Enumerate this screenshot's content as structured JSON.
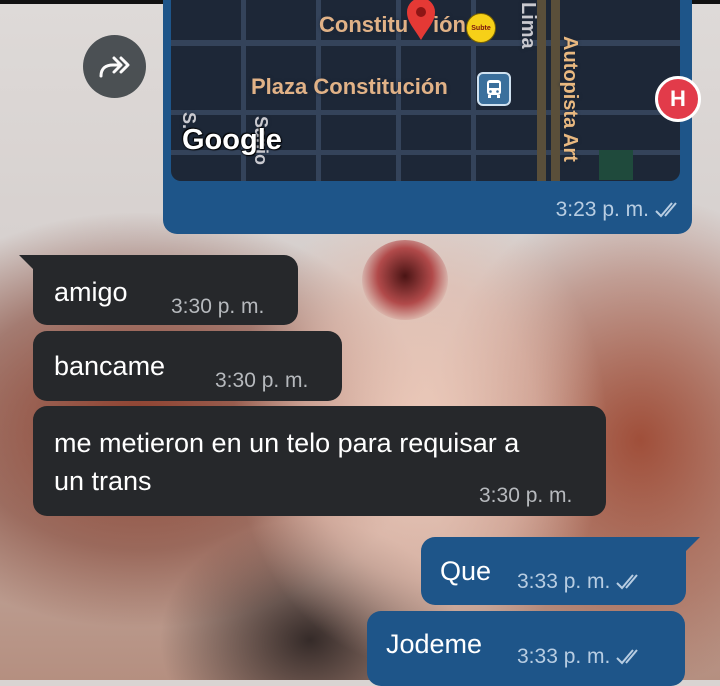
{
  "map": {
    "labels": {
      "constitucion_top": "Constitu",
      "constitucion_end": "ión",
      "plaza": "Plaza Constitución",
      "autopista": "Autopista Art",
      "lima": "Lima",
      "side_left": "S.",
      "side_mid": "Sanjo"
    },
    "subte_text": "Subte",
    "hospital_text": "H",
    "google": "Google",
    "time": "3:23 p. m."
  },
  "messages": [
    {
      "text": "amigo",
      "time": "3:30 p. m.",
      "direction": "in"
    },
    {
      "text": "bancame",
      "time": "3:30 p. m.",
      "direction": "in"
    },
    {
      "line1": "me metieron en un telo para requisar a",
      "line2": "un trans",
      "time": "3:30 p. m.",
      "direction": "in"
    },
    {
      "text": "Que",
      "time": "3:33 p. m.",
      "direction": "out"
    },
    {
      "text": "Jodeme",
      "time": "3:33 p. m.",
      "direction": "out"
    }
  ],
  "colors": {
    "incoming_bubble": "#26282b",
    "outgoing_bubble": "#1e5589",
    "map_bg": "#1d2737"
  }
}
